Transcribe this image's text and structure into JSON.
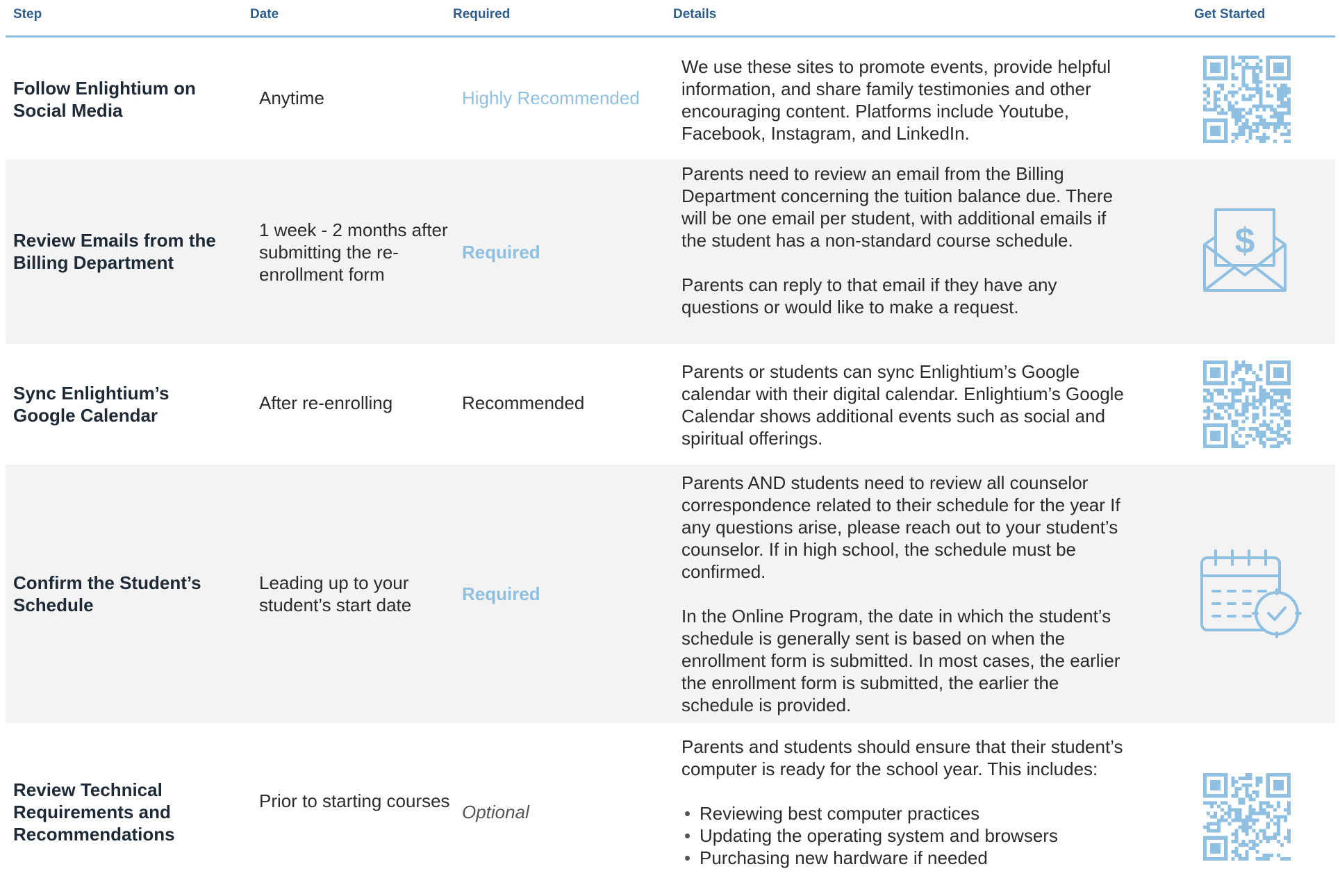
{
  "header": {
    "step": "Step",
    "date": "Date",
    "required": "Required",
    "details": "Details",
    "get_started": "Get Started"
  },
  "rows": [
    {
      "step": "Follow Enlightium on Social Media",
      "date": "Anytime",
      "required": "Highly Recommended",
      "details": [
        "We use these sites to promote events, provide helpful information, and share family testimonies and other encouraging content. Platforms include Youtube, Facebook, Instagram, and LinkedIn."
      ],
      "icon": "qr-code-icon"
    },
    {
      "step": "Review Emails from the Billing Department",
      "date": "1 week - 2 months after submitting the re-enrollment form",
      "required": "Required",
      "details": [
        "Parents need to review an email from the Billing Department concerning the tuition balance due. There will be one email per student, with additional emails if the student has a non-standard course schedule.",
        "Parents can reply to that email if they have any questions or would like to make a request."
      ],
      "icon": "envelope-dollar-icon"
    },
    {
      "step": "Sync Enlightium’s Google Calendar",
      "date": "After re-enrolling",
      "required": "Recommended",
      "details": [
        "Parents or students can sync Enlightium’s Google calendar with their digital calendar. Enlightium’s Google Calendar shows additional events such as social and spiritual offerings."
      ],
      "icon": "qr-code-icon"
    },
    {
      "step": "Confirm the Student’s Schedule",
      "date": "Leading up to your student’s start date",
      "required": "Required",
      "details": [
        "Parents AND students need to review all counselor correspondence related to their schedule for the year If any questions arise, please reach out to your student’s counselor. If in high school, the schedule must be confirmed.",
        "In the Online Program, the date in which the student’s schedule is generally sent is based on when the enrollment form is submitted. In most cases, the earlier the enrollment form is submitted, the earlier the schedule is provided."
      ],
      "icon": "calendar-check-icon"
    },
    {
      "step": "Review Technical Requirements and Recommendations",
      "date": "Prior to starting courses",
      "required": "Optional",
      "details": [
        "Parents and students should ensure that their student’s computer is ready for the school year. This includes:"
      ],
      "bullets": [
        "Reviewing best computer practices",
        "Updating the operating system and browsers",
        "Purchasing new hardware if needed"
      ],
      "icon": "qr-code-icon"
    }
  ],
  "colors": {
    "header_text": "#2e5e8e",
    "accent": "#8fc0e2",
    "rule": "#8dbfe0",
    "shade": "#f3f3f3"
  }
}
